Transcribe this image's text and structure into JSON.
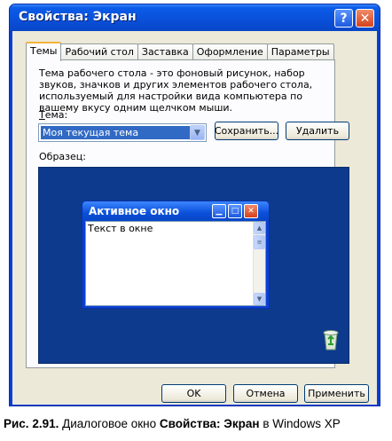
{
  "window": {
    "title": "Свойства: Экран",
    "help_glyph": "?",
    "close_glyph": "✕"
  },
  "tabs": [
    {
      "label": "Темы",
      "active": true
    },
    {
      "label": "Рабочий стол",
      "active": false
    },
    {
      "label": "Заставка",
      "active": false
    },
    {
      "label": "Оформление",
      "active": false
    },
    {
      "label": "Параметры",
      "active": false
    }
  ],
  "themes": {
    "description": "Тема рабочего стола - это фоновый рисунок, набор звуков, значков и других элементов рабочего стола, используемый для настройки вида компьютера по вашему вкусу одним щелчком мыши.",
    "label_accel": "Т",
    "label_rest": "ема:",
    "selected_theme": "Моя текущая тема",
    "save_button": "Сохранить...",
    "delete_button": "Удалить",
    "sample_label": "Образец:"
  },
  "preview": {
    "window_title": "Активное окно",
    "window_text": "Текст в окне"
  },
  "footer": {
    "ok": "OK",
    "cancel": "Отмена",
    "apply": "Применить"
  },
  "caption": {
    "figure": "Рис. 2.91.",
    "text1": " Диалоговое окно ",
    "bold_name": "Свойства: Экран",
    "text2": " в Windows XP"
  },
  "colors": {
    "titlebar": "#0a4fd9",
    "dialog_bg": "#ece9d8",
    "preview_bg": "#0d3a8c",
    "selection": "#316ac5",
    "active_tab_accent": "#f5b33b"
  }
}
